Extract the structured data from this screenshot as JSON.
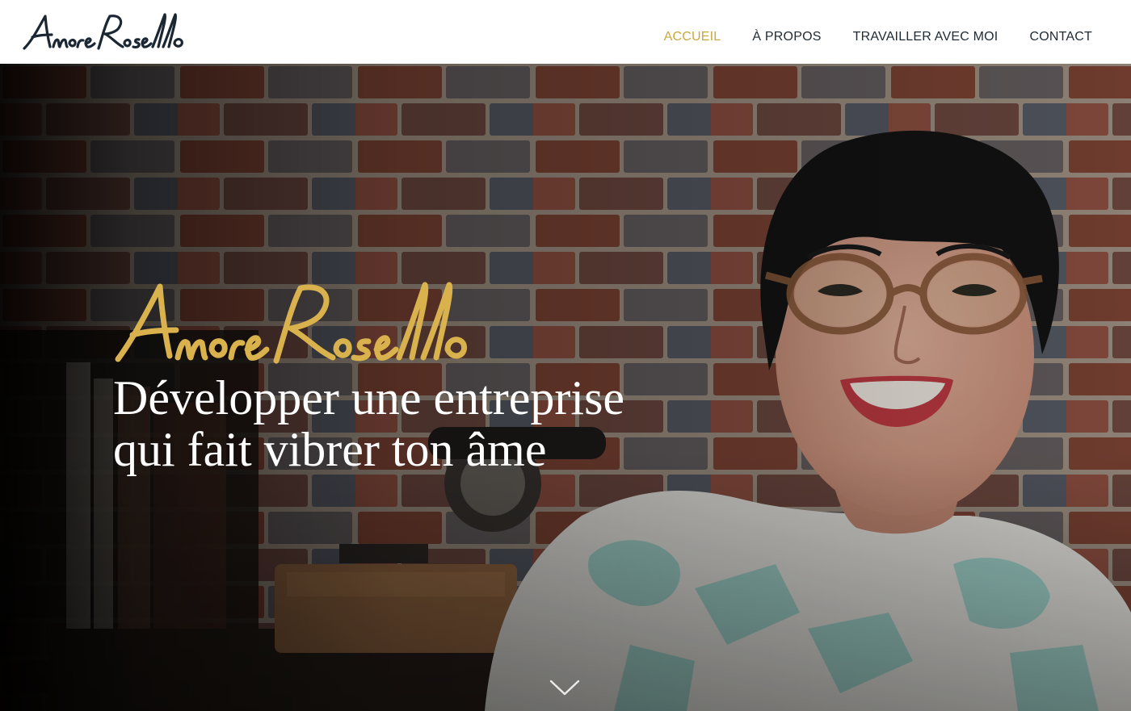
{
  "header": {
    "logo_text": "Amore Rosello",
    "nav": [
      {
        "label": "ACCUEIL",
        "active": true
      },
      {
        "label": "À PROPOS",
        "active": false
      },
      {
        "label": "TRAVAILLER AVEC MOI",
        "active": false
      },
      {
        "label": "CONTACT",
        "active": false
      }
    ]
  },
  "hero": {
    "signature_text": "Amore Rosello",
    "title_line1": "Développer une entreprise",
    "title_line2": "qui fait vibrer ton âme",
    "scroll_icon": "chevron-down-icon"
  },
  "colors": {
    "accent_gold": "#c9a840",
    "nav_text": "#1f2a33",
    "logo_ink": "#1b2733",
    "hero_text": "#ffffff"
  }
}
